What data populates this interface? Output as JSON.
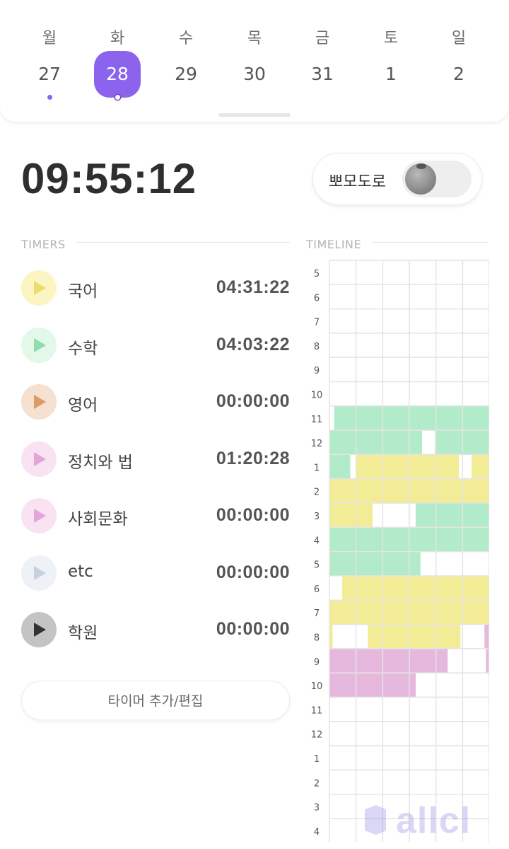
{
  "week": {
    "days": [
      {
        "name": "월",
        "num": "27",
        "dot": true,
        "selected": false
      },
      {
        "name": "화",
        "num": "28",
        "dot": true,
        "selected": true
      },
      {
        "name": "수",
        "num": "29",
        "dot": false,
        "selected": false
      },
      {
        "name": "목",
        "num": "30",
        "dot": false,
        "selected": false
      },
      {
        "name": "금",
        "num": "31",
        "dot": false,
        "selected": false
      },
      {
        "name": "토",
        "num": "1",
        "dot": false,
        "selected": false
      },
      {
        "name": "일",
        "num": "2",
        "dot": false,
        "selected": false
      }
    ],
    "accent": "#8b63ec"
  },
  "clock": "09:55:12",
  "pomodoro": {
    "label": "뽀모도로",
    "on": false,
    "icon": "tomato-icon"
  },
  "timers_title": "TIMERS",
  "timeline_title": "TIMELINE",
  "timers": [
    {
      "name": "국어",
      "time": "04:31:22",
      "color": "#fbf5c4",
      "tri": "#eddc6a"
    },
    {
      "name": "수학",
      "time": "04:03:22",
      "color": "#e2f8e9",
      "tri": "#8fdcac"
    },
    {
      "name": "영어",
      "time": "00:00:00",
      "color": "#f6e0cf",
      "tri": "#dd9a62"
    },
    {
      "name": "정치와 법",
      "time": "01:20:28",
      "color": "#f9e3f2",
      "tri": "#e4a4d6"
    },
    {
      "name": "사회문화",
      "time": "00:00:00",
      "color": "#f9e3f2",
      "tri": "#e4a4d6"
    },
    {
      "name": "etc",
      "time": "00:00:00",
      "color": "#eef1f6",
      "tri": "#c6d0e0"
    },
    {
      "name": "학원",
      "time": "00:00:00",
      "color": "#c4c4c4",
      "tri": "#333333"
    }
  ],
  "add_button": "타이머 추가/편집",
  "timeline": {
    "hours": [
      "5",
      "6",
      "7",
      "8",
      "9",
      "10",
      "11",
      "12",
      "1",
      "2",
      "3",
      "4",
      "5",
      "6",
      "7",
      "8",
      "9",
      "10",
      "11",
      "12",
      "1",
      "2",
      "3",
      "4"
    ],
    "colors": {
      "green": "#b2ebc9",
      "yellow": "#f2ec96",
      "pink": "#e6b8dd"
    },
    "blocks": [
      {
        "h": 6,
        "c": "green",
        "from": 0.03,
        "to": 1.0
      },
      {
        "h": 7,
        "c": "green",
        "from": 0.0,
        "to": 0.58
      },
      {
        "h": 7,
        "c": "green",
        "from": 0.66,
        "to": 1.0
      },
      {
        "h": 8,
        "c": "green",
        "from": 0.0,
        "to": 0.13
      },
      {
        "h": 8,
        "c": "yellow",
        "from": 0.17,
        "to": 0.81
      },
      {
        "h": 8,
        "c": "yellow",
        "from": 0.89,
        "to": 1.0
      },
      {
        "h": 9,
        "c": "yellow",
        "from": 0.0,
        "to": 1.0
      },
      {
        "h": 10,
        "c": "yellow",
        "from": 0.0,
        "to": 0.27
      },
      {
        "h": 10,
        "c": "green",
        "from": 0.54,
        "to": 1.0
      },
      {
        "h": 11,
        "c": "green",
        "from": 0.0,
        "to": 1.0
      },
      {
        "h": 12,
        "c": "green",
        "from": 0.0,
        "to": 0.57
      },
      {
        "h": 13,
        "c": "yellow",
        "from": 0.08,
        "to": 1.0
      },
      {
        "h": 14,
        "c": "yellow",
        "from": 0.0,
        "to": 1.0
      },
      {
        "h": 15,
        "c": "yellow",
        "from": 0.0,
        "to": 0.02
      },
      {
        "h": 15,
        "c": "yellow",
        "from": 0.24,
        "to": 0.82
      },
      {
        "h": 15,
        "c": "pink",
        "from": 0.97,
        "to": 1.0
      },
      {
        "h": 16,
        "c": "pink",
        "from": 0.0,
        "to": 0.74
      },
      {
        "h": 16,
        "c": "pink",
        "from": 0.98,
        "to": 1.0
      },
      {
        "h": 17,
        "c": "pink",
        "from": 0.0,
        "to": 0.54
      }
    ]
  },
  "watermark": "allcl"
}
